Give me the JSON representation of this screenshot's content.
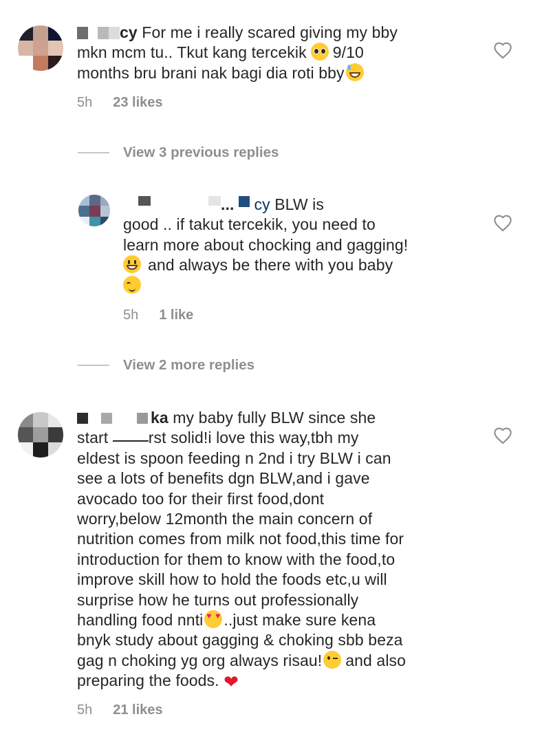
{
  "comments": [
    {
      "username_tail": "cy",
      "lines": [
        "For me i really scared giving my bby",
        "mkn mcm tu.. Tkut kang tercekik",
        "9/10",
        "months bru brani nak bagi dia roti bby"
      ],
      "emojis": [
        "pleading-face-emoji",
        "grinning-sweat-emoji"
      ],
      "time": "5h",
      "likes": "23 likes"
    },
    {
      "view_replies": "View 3 previous replies"
    },
    {
      "username_tail": "...",
      "mention_tail": "cy",
      "lines": [
        "BLW is",
        "good .. if takut tercekik, you need to",
        "learn more about chocking and gagging!",
        "and always be there with you baby"
      ],
      "time": "5h",
      "likes": "1 like"
    },
    {
      "view_replies": "View 2 more replies"
    },
    {
      "username_tail": "ka",
      "lines": [
        "my baby fully BLW since she",
        "start ",
        "rst solid!i love this way,tbh my",
        "eldest is spoon feeding n 2nd i try BLW i can",
        "see a lots of benefits dgn BLW,and i gave",
        "avocado too for their first food,dont",
        "worry,below 12month the main concern of",
        "nutrition comes from milk not food,this time for",
        "introduction for them to know with the food,to",
        "improve skill how to hold the foods etc,u will",
        "surprise how he turns out professionally",
        "handling food nnti",
        "..just make sure kena",
        "bnyk study about gagging & choking sbb beza",
        "gag n choking yg org always risau!",
        "and also",
        "preparing the foods."
      ],
      "time": "5h",
      "likes": "21 likes"
    }
  ],
  "colors": {
    "text": "#262626",
    "secondary": "#8e8e8e",
    "mention": "#00376b",
    "heart_outline": "#8e8e8e"
  },
  "icons": [
    "heart-outline-icon",
    "avatar-blurred"
  ]
}
